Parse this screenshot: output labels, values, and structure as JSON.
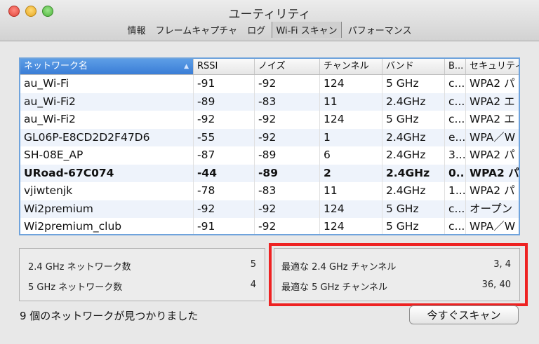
{
  "window": {
    "title": "ユーティリティ"
  },
  "toolbar": {
    "items": [
      {
        "label": "情報"
      },
      {
        "label": "フレームキャプチャ"
      },
      {
        "label": "ログ"
      },
      {
        "label": "Wi-Fi スキャン"
      },
      {
        "label": "パフォーマンス"
      }
    ],
    "active": "Wi-Fi スキャン"
  },
  "table": {
    "columns": [
      "ネットワーク名",
      "RSSI",
      "ノイズ",
      "チャンネル",
      "バンド",
      "B...",
      "セキュリティ"
    ],
    "sorted_column": "ネットワーク名",
    "rows": [
      {
        "name": "au_Wi-Fi",
        "rssi": "-91",
        "noise": "-92",
        "channel": "124",
        "band": "5 GHz",
        "b": "c...",
        "security": "WPA2 パ"
      },
      {
        "name": "au_Wi-Fi2",
        "rssi": "-89",
        "noise": "-83",
        "channel": "11",
        "band": "2.4GHz",
        "b": "c...",
        "security": "WPA2 エ"
      },
      {
        "name": "au_Wi-Fi2",
        "rssi": "-92",
        "noise": "-92",
        "channel": "124",
        "band": "5 GHz",
        "b": "c...",
        "security": "WPA2 エ"
      },
      {
        "name": "GL06P-E8CD2D2F47D6",
        "rssi": "-55",
        "noise": "-92",
        "channel": "1",
        "band": "2.4GHz",
        "b": "e...",
        "security": "WPA／W"
      },
      {
        "name": "SH-08E_AP",
        "rssi": "-87",
        "noise": "-89",
        "channel": "6",
        "band": "2.4GHz",
        "b": "3...",
        "security": "WPA2 パ"
      },
      {
        "name": "URoad-67C074",
        "rssi": "-44",
        "noise": "-89",
        "channel": "2",
        "band": "2.4GHz",
        "b": "0...",
        "security": "WPA2 パ",
        "bold": true
      },
      {
        "name": "vjiwtenjk",
        "rssi": "-78",
        "noise": "-83",
        "channel": "11",
        "band": "2.4GHz",
        "b": "1...",
        "security": "WPA2 パ"
      },
      {
        "name": "Wi2premium",
        "rssi": "-92",
        "noise": "-92",
        "channel": "124",
        "band": "5 GHz",
        "b": "c...",
        "security": "オープン"
      },
      {
        "name": "Wi2premium_club",
        "rssi": "-91",
        "noise": "-92",
        "channel": "124",
        "band": "5 GHz",
        "b": "c...",
        "security": "WPA／W"
      }
    ]
  },
  "stats": {
    "left": [
      {
        "label": "2.4 GHz ネットワーク数",
        "value": "5"
      },
      {
        "label": "5 GHz ネットワーク数",
        "value": "4"
      }
    ],
    "right": [
      {
        "label": "最適な 2.4 GHz チャンネル",
        "value": "3, 4"
      },
      {
        "label": "最適な 5 GHz チャンネル",
        "value": "36, 40"
      }
    ]
  },
  "footer": {
    "status": "9 個のネットワークが見つかりました",
    "scan_button": "今すぐスキャン"
  },
  "colors": {
    "highlight": "#ee2222",
    "selected_header": "#3a7dd6"
  }
}
